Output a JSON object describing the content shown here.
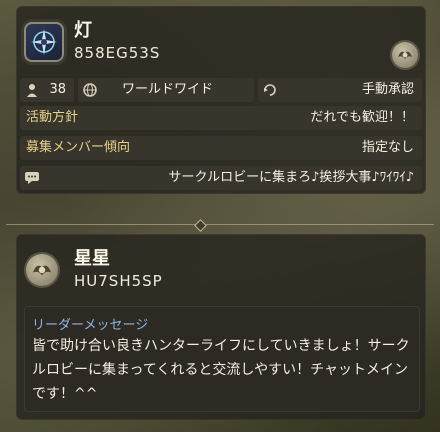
{
  "group": {
    "name": "灯",
    "code": "858EG53S",
    "level": "38",
    "region": "ワールドワイド",
    "approval": "手動承認",
    "policy_label": "活動方針",
    "policy_value": "だれでも歓迎！！",
    "recruit_label": "募集メンバー傾向",
    "recruit_value": "指定なし",
    "comment": "サークルロビーに集まろ♪挨拶大事♪ﾜｲﾜｲ♪"
  },
  "leader": {
    "name": "星星",
    "code": "HU7SH5SP",
    "message_title": "リーダーメッセージ",
    "message": "皆で助け合い良きハンターライフにしていきましょ！サークルロビーに集まってくれると交流しやすい！チャットメインです！^^"
  },
  "colors": {
    "label_gold": "#e6d08a",
    "message_title_blue": "#8fb4e8"
  },
  "icons": {
    "emblem": "compass-star-icon",
    "badge": "wing-badge-icon",
    "level": "member-count-icon",
    "region": "globe-icon",
    "approval": "approval-icon",
    "comment": "chat-icon"
  }
}
